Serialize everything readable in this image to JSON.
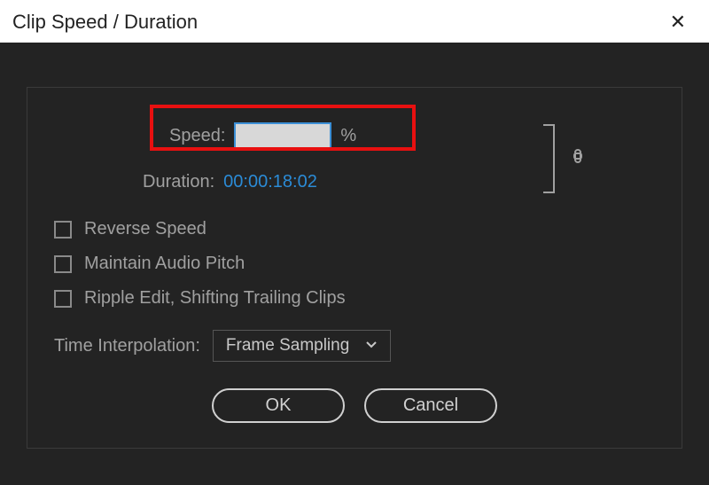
{
  "titlebar": {
    "title": "Clip Speed / Duration"
  },
  "speed": {
    "label": "Speed:",
    "value": "",
    "unit": "%"
  },
  "duration": {
    "label": "Duration:",
    "value": "00:00:18:02"
  },
  "checkboxes": {
    "reverse": "Reverse Speed",
    "maintain_pitch": "Maintain Audio Pitch",
    "ripple": "Ripple Edit, Shifting Trailing Clips"
  },
  "interpolation": {
    "label": "Time Interpolation:",
    "selected": "Frame Sampling"
  },
  "buttons": {
    "ok": "OK",
    "cancel": "Cancel"
  }
}
